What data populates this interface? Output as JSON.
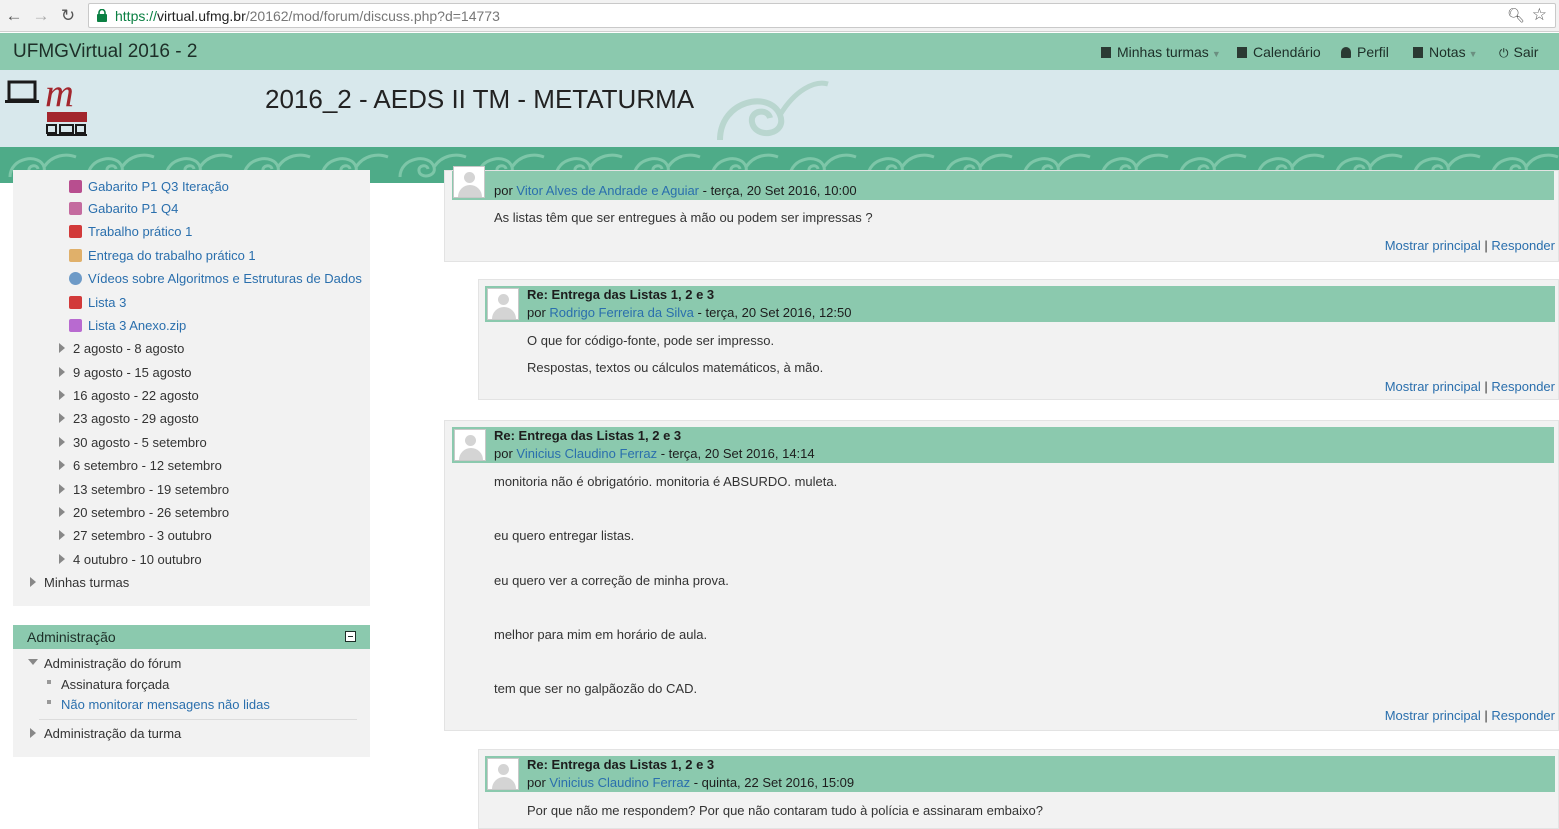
{
  "browser": {
    "url_scheme": "https://",
    "url_host": "virtual.ufmg.br",
    "url_path": "/20162/mod/forum/discuss.php?d=14773"
  },
  "navbar": {
    "site_name": "UFMGVirtual 2016 - 2",
    "items": [
      {
        "label": "Minhas turmas",
        "icon": "book-icon"
      },
      {
        "label": "Calendário",
        "icon": "calendar-icon"
      },
      {
        "label": "Perfil",
        "icon": "user-icon"
      },
      {
        "label": "Notas",
        "icon": "grades-icon"
      },
      {
        "label": "Sair",
        "icon": "power-icon"
      }
    ]
  },
  "header": {
    "course_title": "2016_2 - AEDS II TM - METATURMA"
  },
  "navigation": {
    "files": [
      {
        "label": "Gabarito P1 Q3 Iteração",
        "icon": "pdf-icon"
      },
      {
        "label": "Gabarito P1 Q4",
        "icon": "pdf-icon"
      },
      {
        "label": "Trabalho prático 1",
        "icon": "pdf-icon"
      },
      {
        "label": "Entrega do trabalho prático 1",
        "icon": "assignment-icon"
      },
      {
        "label": "Vídeos sobre Algoritmos e Estruturas de Dados",
        "icon": "url-icon"
      },
      {
        "label": "Lista 3",
        "icon": "pdf-icon"
      },
      {
        "label": "Lista 3 Anexo.zip",
        "icon": "zip-icon"
      }
    ],
    "weeks": [
      "2 agosto - 8 agosto",
      "9 agosto - 15 agosto",
      "16 agosto - 22 agosto",
      "23 agosto - 29 agosto",
      "30 agosto - 5 setembro",
      "6 setembro - 12 setembro",
      "13 setembro - 19 setembro",
      "20 setembro - 26 setembro",
      "27 setembro - 3 outubro",
      "4 outubro - 10 outubro"
    ],
    "my_courses": "Minhas turmas"
  },
  "admin": {
    "title": "Administração",
    "forum_admin": "Administração do fórum",
    "forced_subscription": "Assinatura forçada",
    "dont_track": "Não monitorar mensagens não lidas",
    "course_admin": "Administração da turma"
  },
  "posts": [
    {
      "by_prefix": "por ",
      "author": "Vitor Alves de Andrade e Aguiar",
      "date": " - terça, 20 Set 2016, 10:00",
      "paragraphs": [
        "As listas têm que ser entregues à mão ou podem ser impressas ?"
      ],
      "show_parent": "Mostrar principal",
      "reply": "Responder"
    },
    {
      "subject": "Re: Entrega das Listas 1, 2 e 3",
      "by_prefix": "por ",
      "author": "Rodrigo Ferreira da Silva",
      "date": " - terça, 20 Set 2016, 12:50",
      "paragraphs": [
        "O que for código-fonte, pode ser impresso.",
        "Respostas, textos ou cálculos matemáticos, à mão."
      ],
      "show_parent": "Mostrar principal",
      "reply": "Responder"
    },
    {
      "subject": "Re: Entrega das Listas 1, 2 e 3",
      "by_prefix": "por ",
      "author": "Vinicius Claudino Ferraz",
      "date": " - terça, 20 Set 2016, 14:14",
      "paragraphs": [
        "monitoria não é obrigatório. monitoria é ABSURDO. muleta.",
        "eu quero entregar listas.",
        "eu quero ver a correção de minha prova.",
        "melhor para mim em horário de aula.",
        "tem que ser no galpãozão do CAD."
      ],
      "show_parent": "Mostrar principal",
      "reply": "Responder"
    },
    {
      "subject": "Re: Entrega das Listas 1, 2 e 3",
      "by_prefix": "por ",
      "author": "Vinicius Claudino Ferraz",
      "date": " - quinta, 22 Set 2016, 15:09",
      "paragraphs": [
        "Por que não me respondem? Por que não contaram tudo à polícia e assinaram embaixo?"
      ]
    }
  ],
  "separator": " | "
}
